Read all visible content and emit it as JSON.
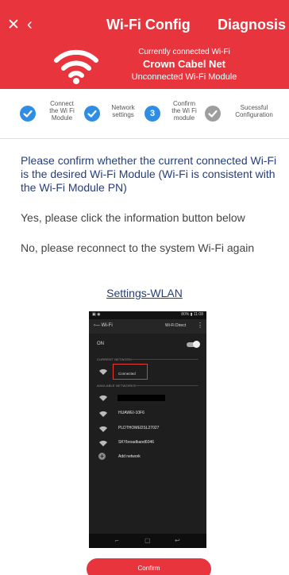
{
  "header": {
    "close_icon": "close-icon",
    "back_icon": "chevron-left-icon",
    "title": "Wi-Fi Config",
    "diagnosis_label": "Diagnosis",
    "status_line1": "Currently connected Wi-Fi",
    "network_name": "Crown Cabel Net",
    "status_line3": "Unconnected Wi-Fi Module",
    "background_color": "#e8343c"
  },
  "steps": [
    {
      "label_lines": [
        "Connect",
        "the Wi Fi",
        "Module"
      ],
      "state": "done",
      "icon": "check-icon"
    },
    {
      "label_lines": [
        "Network",
        "settings"
      ],
      "state": "done",
      "icon": "check-icon"
    },
    {
      "number": "3",
      "label_lines": [
        "Confirm",
        "the Wi Fi",
        "module"
      ],
      "state": "current"
    },
    {
      "label_lines": [
        "Sucessful",
        "Configuration"
      ],
      "state": "pending",
      "icon": "check-icon"
    }
  ],
  "content": {
    "instruction": "Please confirm whether the current connected Wi-Fi is the desired Wi-Fi Module (Wi-Fi is consistent with the Wi-Fi Module PN)",
    "yes_text": "Yes, please click the information button below",
    "no_text": "No, please reconnect to the system Wi-Fi again",
    "settings_link": "Settings-WLAN",
    "text_color": "#253e7a"
  },
  "phone_screenshot": {
    "status_time": "11:08",
    "status_battery": "80%",
    "back_title": "Wi-Fi",
    "wifi_direct": "Wi-Fi Direct",
    "on_label": "ON",
    "current_network_label": "CURRENT NETWORK",
    "connected_label": "Connected",
    "available_networks_label": "AVAILABLE NETWORKS",
    "networks": [
      "HUAWEI-10F6",
      "PLDTHOMEDSL27027",
      "SKYbroadband6046"
    ],
    "add_network": "Add network"
  },
  "confirm_label": "Confirm",
  "accent_color": "#2f8de4"
}
